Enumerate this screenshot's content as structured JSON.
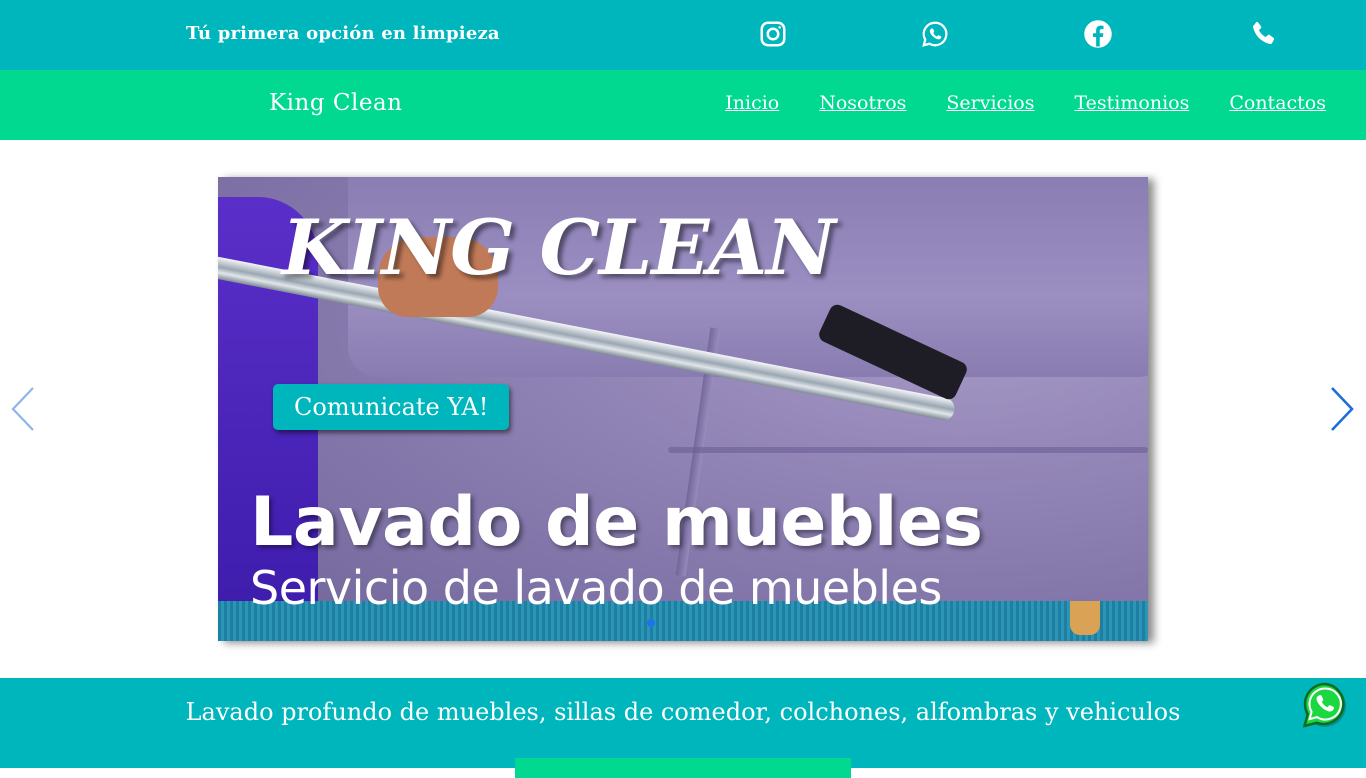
{
  "topbar": {
    "tagline": "Tú primera opción en limpieza",
    "icons": [
      "instagram-icon",
      "whatsapp-icon",
      "facebook-icon",
      "phone-icon"
    ],
    "background": "#00b6bd"
  },
  "navbar": {
    "brand": "King Clean",
    "links": [
      "Inicio",
      "Nosotros",
      "Servicios",
      "Testimonios",
      "Contactos"
    ],
    "background": "#00d98f"
  },
  "carousel": {
    "slide_title": "KING CLEAN",
    "cta_label": "Comunicate YA!",
    "heading": "Lavado de muebles",
    "subheading": "Servicio de lavado de muebles",
    "prev_icon": "chevron-left-icon",
    "next_icon": "chevron-right-icon",
    "active_indicator": 1,
    "indicator_count": 1
  },
  "band": {
    "text": "Lavado profundo de muebles, sillas de comedor, colchones, alfombras y vehiculos",
    "background": "#00b6bd"
  },
  "floating": {
    "icon": "whatsapp-icon"
  }
}
